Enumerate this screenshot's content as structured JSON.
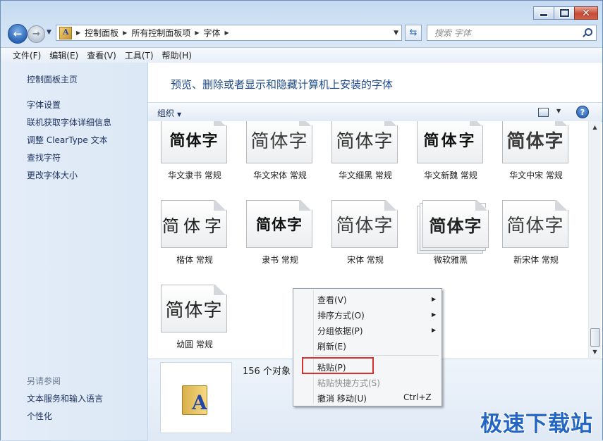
{
  "nav": {
    "breadcrumbs": [
      "控制面板",
      "所有控制面板项",
      "字体"
    ],
    "search_placeholder": "搜索 字体"
  },
  "menubar": [
    "文件(F)",
    "编辑(E)",
    "查看(V)",
    "工具(T)",
    "帮助(H)"
  ],
  "left_pane": {
    "tasks": [
      "控制面板主页",
      "字体设置",
      "联机获取字体详细信息",
      "调整 ClearType 文本",
      "查找字符",
      "更改字体大小"
    ],
    "see_also_heading": "另请参阅",
    "see_also": [
      "文本服务和输入语言",
      "个性化"
    ]
  },
  "main": {
    "title": "预览、删除或者显示和隐藏计算机上安装的字体",
    "organize_label": "组织",
    "fonts": [
      {
        "label": "华文隶书 常规",
        "sample": "简体字"
      },
      {
        "label": "华文宋体 常规",
        "sample": "简体字"
      },
      {
        "label": "华文细黑 常规",
        "sample": "简体字"
      },
      {
        "label": "华文新魏 常规",
        "sample": "简体字"
      },
      {
        "label": "华文中宋 常规",
        "sample": "简体字"
      },
      {
        "label": "楷体 常规",
        "sample": "简体字"
      },
      {
        "label": "隶书 常规",
        "sample": "简体字"
      },
      {
        "label": "宋体 常规",
        "sample": "简体字"
      },
      {
        "label": "微软雅黑",
        "sample": "简体字"
      },
      {
        "label": "新宋体 常规",
        "sample": "简体字"
      },
      {
        "label": "幼圆 常规",
        "sample": "简体字"
      }
    ],
    "object_count": "156 个对象"
  },
  "context_menu": {
    "view": "查看(V)",
    "sort": "排序方式(O)",
    "group": "分组依据(P)",
    "refresh": "刷新(E)",
    "paste": "粘贴(P)",
    "paste_shortcut": "粘贴快捷方式(S)",
    "undo": "撤消 移动(U)",
    "undo_shortcut": "Ctrl+Z"
  },
  "watermark": "极速下载站",
  "colors": {
    "accent": "#1d4a8e",
    "highlight_box": "#d6322b",
    "watermark": "#2466c4"
  }
}
